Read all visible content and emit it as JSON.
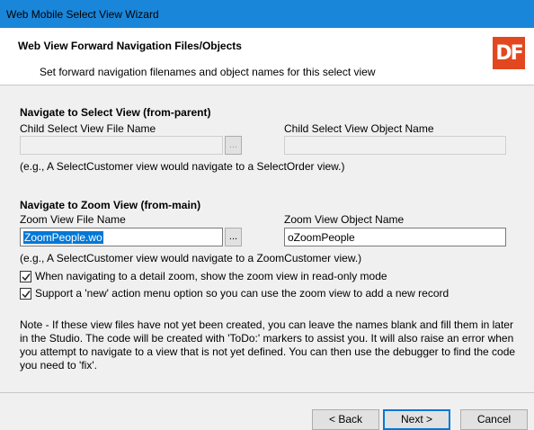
{
  "window": {
    "title": "Web Mobile Select View Wizard"
  },
  "header": {
    "title": "Web View Forward Navigation Files/Objects",
    "subtitle": "Set forward navigation filenames and object names for this select view",
    "logo_text": "DF",
    "logo_color": "#e2471f"
  },
  "select_section": {
    "heading": "Navigate to Select View (from-parent)",
    "file_label": "Child Select View File Name",
    "file_value": "",
    "object_label": "Child Select View Object Name",
    "object_value": "",
    "browse_label": "...",
    "hint": "(e.g., A SelectCustomer view would navigate to a SelectOrder view.)"
  },
  "zoom_section": {
    "heading": "Navigate to Zoom View (from-main)",
    "file_label": "Zoom View File Name",
    "file_value": "ZoomPeople.wo",
    "object_label": "Zoom View Object Name",
    "object_value": "oZoomPeople",
    "browse_label": "...",
    "hint": "(e.g., A SelectCustomer view would navigate to a ZoomCustomer view.)"
  },
  "options": [
    {
      "label": "When navigating to a detail zoom, show the zoom view in read-only mode",
      "checked": true
    },
    {
      "label": "Support a 'new' action menu option so you can use the zoom view to add a new record",
      "checked": true
    }
  ],
  "note": "Note - If these view files have not yet been created, you can leave the names blank and fill them in later in the Studio. The code will be created with 'ToDo:' markers to assist you. It will also raise an error when you attempt to navigate to a view that is not yet defined. You can then use the debugger to find the code you need to 'fix'.",
  "buttons": {
    "back": "< Back",
    "next": "Next >",
    "cancel": "Cancel"
  },
  "colors": {
    "titlebar": "#1a86d9",
    "selection": "#0078d7"
  }
}
